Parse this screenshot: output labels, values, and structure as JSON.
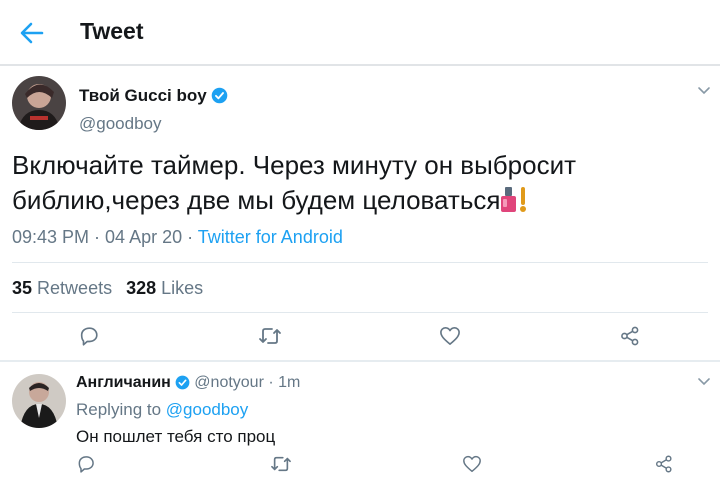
{
  "header": {
    "title": "Tweet"
  },
  "tweet": {
    "author_name": "Твой Gucci boy",
    "handle": "@goodboy",
    "text": "Включайте таймер. Через минуту он выбросит библию,через две мы будем целоваться",
    "time": "09:43 PM",
    "sep1": " · ",
    "date": "04 Apr 20",
    "sep2": " · ",
    "source": "Twitter for Android",
    "retweets_count": "35",
    "retweets_label": "Retweets",
    "likes_count": "328",
    "likes_label": "Likes"
  },
  "reply": {
    "author_name": "Англичанин",
    "handle": "@notyour",
    "sep": " · ",
    "age": "1m",
    "replying_prefix": "Replying to ",
    "replying_to": "@goodboy",
    "text": "Он пошлет тебя сто проц"
  },
  "colors": {
    "accent": "#1da1f2",
    "muted": "#657786",
    "border": "#e1e8ed"
  }
}
